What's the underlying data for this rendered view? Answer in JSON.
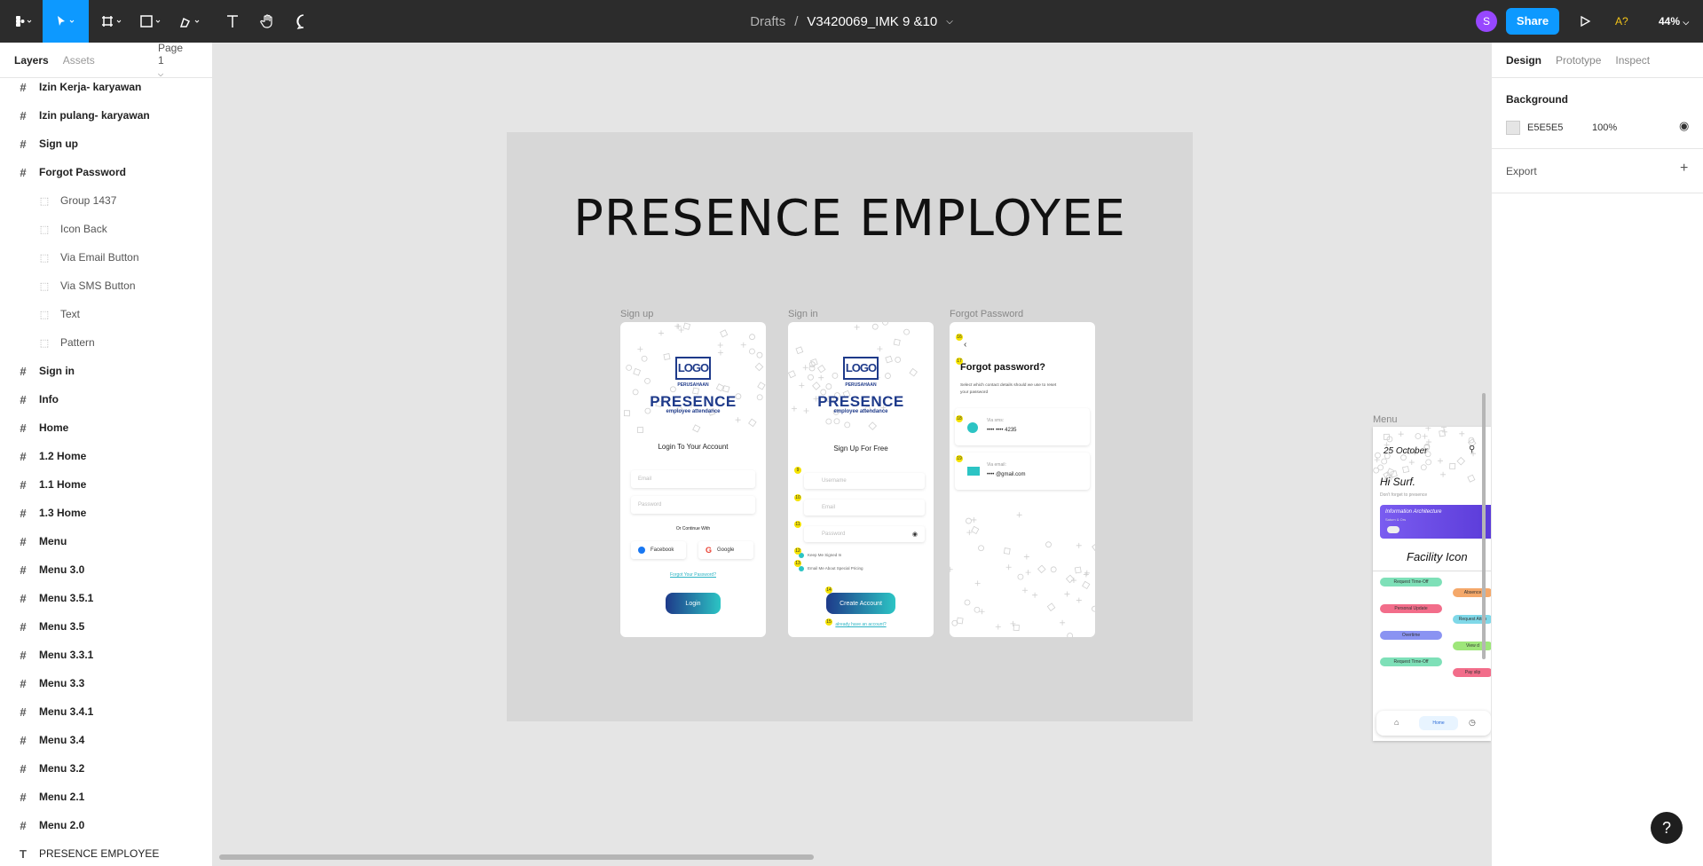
{
  "toolbar": {
    "breadcrumb_parent": "Drafts",
    "breadcrumb_sep": "/",
    "file_name": "V3420069_IMK 9 &10",
    "avatar_letter": "S",
    "share_label": "Share",
    "a11y_label": "A?",
    "zoom": "44%",
    "accent": "#0d99ff"
  },
  "left_panel": {
    "tabs": [
      "Layers",
      "Assets"
    ],
    "page_selector": "Page 1",
    "layers": [
      {
        "label": "Izin Kerja- karyawan",
        "type": "frame",
        "level": 0
      },
      {
        "label": "Izin pulang- karyawan",
        "type": "frame",
        "level": 0
      },
      {
        "label": "Sign up",
        "type": "frame",
        "level": 0
      },
      {
        "label": "Forgot Password",
        "type": "frame",
        "level": 0
      },
      {
        "label": "Group 1437",
        "type": "group",
        "level": 1
      },
      {
        "label": "Icon Back",
        "type": "group",
        "level": 1
      },
      {
        "label": "Via Email Button",
        "type": "group",
        "level": 1
      },
      {
        "label": "Via SMS Button",
        "type": "group",
        "level": 1
      },
      {
        "label": "Text",
        "type": "group",
        "level": 1
      },
      {
        "label": "Pattern",
        "type": "group",
        "level": 1
      },
      {
        "label": "Sign in",
        "type": "frame",
        "level": 0
      },
      {
        "label": "Info",
        "type": "frame",
        "level": 0
      },
      {
        "label": "Home",
        "type": "frame",
        "level": 0
      },
      {
        "label": "1.2 Home",
        "type": "frame",
        "level": 0
      },
      {
        "label": "1.1 Home",
        "type": "frame",
        "level": 0
      },
      {
        "label": "1.3 Home",
        "type": "frame",
        "level": 0
      },
      {
        "label": "Menu",
        "type": "frame",
        "level": 0
      },
      {
        "label": "Menu 3.0",
        "type": "frame",
        "level": 0
      },
      {
        "label": "Menu 3.5.1",
        "type": "frame",
        "level": 0
      },
      {
        "label": "Menu 3.5",
        "type": "frame",
        "level": 0
      },
      {
        "label": "Menu 3.3.1",
        "type": "frame",
        "level": 0
      },
      {
        "label": "Menu 3.3",
        "type": "frame",
        "level": 0
      },
      {
        "label": "Menu 3.4.1",
        "type": "frame",
        "level": 0
      },
      {
        "label": "Menu 3.4",
        "type": "frame",
        "level": 0
      },
      {
        "label": "Menu 3.2",
        "type": "frame",
        "level": 0
      },
      {
        "label": "Menu 2.1",
        "type": "frame",
        "level": 0
      },
      {
        "label": "Menu 2.0",
        "type": "frame",
        "level": 0
      },
      {
        "label": "PRESENCE EMPLOYEE",
        "type": "text",
        "level": 0
      }
    ]
  },
  "right_panel": {
    "tabs": [
      "Design",
      "Prototype",
      "Inspect"
    ],
    "background_heading": "Background",
    "background_hex": "E5E5E5",
    "background_opacity": "100%",
    "export_heading": "Export"
  },
  "canvas": {
    "title": "PRESENCE EMPLOYEE",
    "frame_labels": {
      "signup": "Sign up",
      "signin": "Sign in",
      "forgot": "Forgot Password",
      "menu": "Menu"
    },
    "logo_text": "LOGO",
    "logo_sub": "PERUSAHAAN",
    "brand": "PRESENCE",
    "brand_sub": "employee attendance",
    "signup": {
      "heading": "Login To Your Account",
      "email": "Email",
      "password": "Password",
      "or_continue": "Or Continue With",
      "facebook": "Facebook",
      "google": "Google",
      "forgot_link": "Forgot Your Password?",
      "login_btn": "Login"
    },
    "signin": {
      "heading": "Sign Up For Free",
      "username": "Username",
      "email": "Email",
      "password": "Password",
      "keep_signed": "Keep Me Signed In",
      "email_me": "Email Me About Special Pricing",
      "create_btn": "Create Account",
      "already": "already have an account?",
      "badges": [
        "9",
        "10",
        "11",
        "12",
        "13",
        "14",
        "15"
      ]
    },
    "forgot": {
      "title": "Forgot password?",
      "desc": "Select which contact details should we use to reset your password",
      "via_sms": "Via sms:",
      "sms_value": "•••• •••• 4235",
      "via_email": "Via email:",
      "email_value": "•••• @gmail.com",
      "badges": [
        "16",
        "17",
        "18",
        "19"
      ]
    },
    "menu": {
      "date": "25 October",
      "greeting": "Hi Surf.",
      "reminder": "Don't forget to presence",
      "card_title": "Information Architecture",
      "card_sub": "Saturn & Ors",
      "facility": "Facility Icon",
      "pills": [
        {
          "label": "Request Time-Off",
          "color": "#7ee0b8"
        },
        {
          "label": "Absence",
          "color": "#f4a86a"
        },
        {
          "label": "Personal Update",
          "color": "#f26d8a"
        },
        {
          "label": "Request Atten",
          "color": "#7fd8e8"
        },
        {
          "label": "Overtime",
          "color": "#8a93f2"
        },
        {
          "label": "View d",
          "color": "#9ee67a"
        },
        {
          "label": "Request Time-Off",
          "color": "#7ee0b8"
        },
        {
          "label": "Pay slip",
          "color": "#f26d8a"
        }
      ],
      "nav_home": "Home"
    }
  }
}
